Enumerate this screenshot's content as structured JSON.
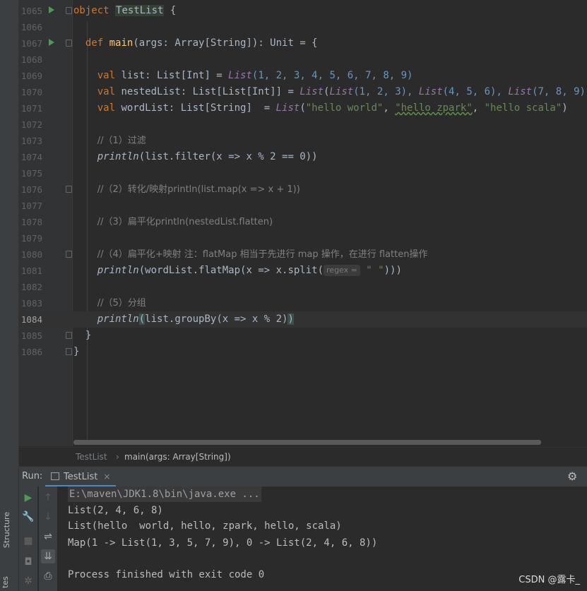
{
  "editor": {
    "current_line": "1084",
    "lines": [
      {
        "n": "1065",
        "run": true,
        "fold": "open"
      },
      {
        "n": "1066"
      },
      {
        "n": "1067",
        "run": true,
        "fold": "open"
      },
      {
        "n": "1068"
      },
      {
        "n": "1069"
      },
      {
        "n": "1070"
      },
      {
        "n": "1071"
      },
      {
        "n": "1072"
      },
      {
        "n": "1073"
      },
      {
        "n": "1074"
      },
      {
        "n": "1075"
      },
      {
        "n": "1076",
        "fold": "open"
      },
      {
        "n": "1077"
      },
      {
        "n": "1078"
      },
      {
        "n": "1079"
      },
      {
        "n": "1080",
        "fold": "open"
      },
      {
        "n": "1081"
      },
      {
        "n": "1082"
      },
      {
        "n": "1083"
      },
      {
        "n": "1084"
      },
      {
        "n": "1085",
        "fold": "close"
      },
      {
        "n": "1086",
        "fold": "close"
      }
    ],
    "code": {
      "l1065": {
        "kw": "object",
        "name": "TestList",
        "rest": " {"
      },
      "l1067": {
        "kw": "def",
        "name": "main",
        "rest": "(args: Array[String]): Unit = {"
      },
      "l1069": {
        "kw": "val",
        "decl": " list: List[Int] = ",
        "call": "List",
        "args": "(1, 2, 3, 4, 5, 6, 7, 8, 9)"
      },
      "l1070": {
        "kw": "val",
        "decl": " nestedList: List[List[Int]] = ",
        "call": "List",
        "open": "(",
        "a1": "List",
        "a1v": "(1, 2, 3), ",
        "a2": "List",
        "a2v": "(4, 5, 6), ",
        "a3": "List",
        "a3v": "(7, 8, 9))"
      },
      "l1071": {
        "kw": "val",
        "decl": " wordList: List[String]  = ",
        "call": "List",
        "s1": "\"hello world\"",
        "s2": "\"hello zpark\"",
        "s3": "\"hello scala\"",
        "sep": ", ",
        "close": ")"
      },
      "l1073": {
        "comment": "//（1）过滤"
      },
      "l1074": {
        "fn": "println",
        "rest": "(list.filter(x => x % 2 == 0))"
      },
      "l1076": {
        "comment": "//（2）转化/映射println(list.map(x => x + 1))"
      },
      "l1078": {
        "comment": "//（3）扁平化println(nestedList.flatten)"
      },
      "l1080": {
        "comment": "//（4）扁平化+映射 注：flatMap 相当于先进行 map 操作，在进行 flatten操作"
      },
      "l1081": {
        "fn": "println",
        "rest": "(wordList.flatMap(x => x.split(",
        "hint": "regex =",
        "arg": "\" \"",
        "end": ")))"
      },
      "l1083": {
        "comment": "//（5）分组"
      },
      "l1084": {
        "fn": "println",
        "open": "(",
        "rest": "list.groupBy(x => x % 2)",
        "close": ")"
      },
      "l1085": {
        "text": "  }"
      },
      "l1086": {
        "text": "}"
      }
    }
  },
  "breadcrumb": {
    "items": [
      "TestList",
      "main(args: Array[String])"
    ],
    "separator": "›"
  },
  "run_panel": {
    "label": "Run:",
    "tab": "TestList",
    "tab_close": "×",
    "settings_icon": "gear-icon",
    "output": [
      "E:\\maven\\JDK1.8\\bin\\java.exe ...",
      "List(2, 4, 6, 8)",
      "List(hello  world, hello, zpark, hello, scala)",
      "Map(1 -> List(1, 3, 5, 7, 9), 0 -> List(2, 4, 6, 8))",
      "",
      "Process finished with exit code 0"
    ]
  },
  "side_tabs": {
    "structure": "Structure",
    "bottom": "tes"
  },
  "watermark": "CSDN @露卡_",
  "colors": {
    "keyword": "#cc7832",
    "function": "#ffc66d",
    "number": "#6897bb",
    "string": "#6a8759",
    "comment": "#808080",
    "run_green": "#499c54",
    "tab_underline": "#4a88c7"
  }
}
